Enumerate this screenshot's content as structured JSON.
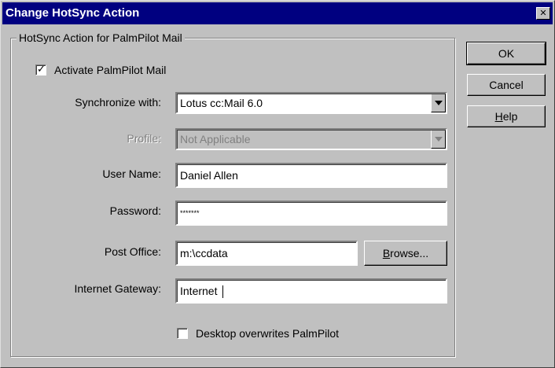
{
  "window": {
    "title": "Change HotSync Action",
    "close_glyph": "✕"
  },
  "group": {
    "label": "HotSync Action for PalmPilot Mail"
  },
  "activate": {
    "label": "Activate PalmPilot Mail",
    "checked": true,
    "check_glyph": "✓"
  },
  "sync_with": {
    "label": "Synchronize with:",
    "value": "Lotus cc:Mail 6.0"
  },
  "profile": {
    "label": "Profile:",
    "value": "Not Applicable",
    "disabled": true
  },
  "user_name": {
    "label": "User Name:",
    "value": "Daniel Allen"
  },
  "password": {
    "label": "Password:",
    "value": "*******"
  },
  "post_office": {
    "label": "Post Office:",
    "value": "m:\\ccdata",
    "browse_label": "Browse..."
  },
  "internet_gateway": {
    "label": "Internet Gateway:",
    "value": "Internet"
  },
  "overwrite": {
    "label": "Desktop overwrites PalmPilot",
    "checked": false
  },
  "buttons": {
    "ok": "OK",
    "cancel": "Cancel",
    "help": "Help"
  }
}
